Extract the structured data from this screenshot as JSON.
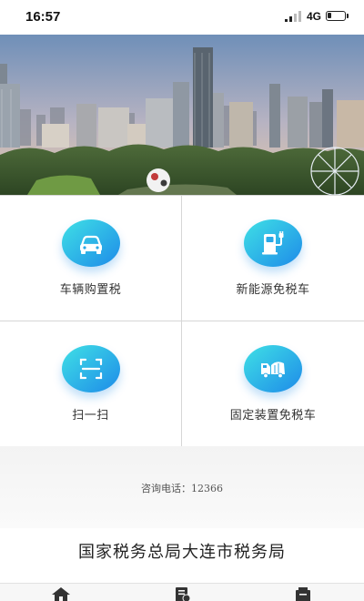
{
  "status_bar": {
    "time": "16:57",
    "network": "4G"
  },
  "banner": {
    "icon": "dalian-city-skyline-photo"
  },
  "services": [
    {
      "label": "车辆购置税",
      "icon": "car-icon"
    },
    {
      "label": "新能源免税车",
      "icon": "charging-station-icon"
    },
    {
      "label": "扫一扫",
      "icon": "scan-icon"
    },
    {
      "label": "固定装置免税车",
      "icon": "truck-icon"
    }
  ],
  "hotline": {
    "text": "咨询电话：12366"
  },
  "footer": {
    "org_name": "国家税务总局大连市税务局"
  },
  "tabbar": {
    "icons": [
      "home-icon",
      "document-icon",
      "box-icon"
    ]
  },
  "colors": {
    "accent_gradient_start": "#3fe0e6",
    "accent_gradient_end": "#1e8be8"
  }
}
